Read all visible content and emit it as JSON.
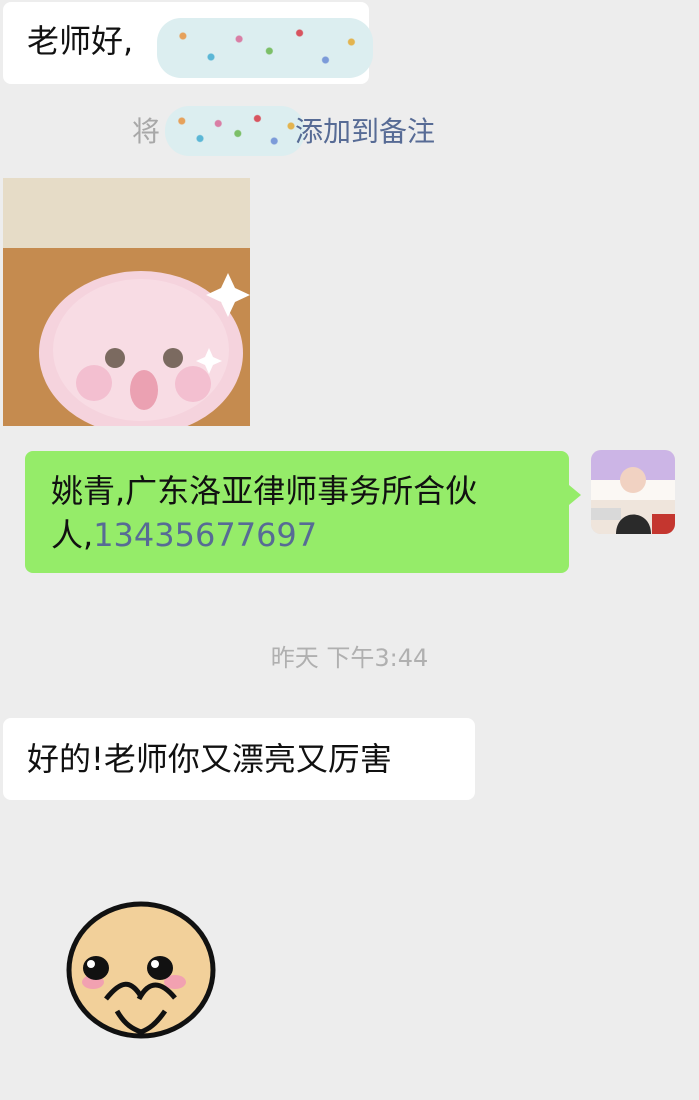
{
  "messages": {
    "first": {
      "text": "老师好,"
    },
    "remark": {
      "prefix": "将",
      "suffix": "添加到备注"
    },
    "intro": {
      "text_prefix": "姚青,广东洛亚律师事务所合伙人,",
      "phone": "13435677697"
    },
    "timestamp": "昨天 下午3:44",
    "reply": {
      "text": "好的!老师你又漂亮又厉害"
    }
  },
  "colors": {
    "background": "#ededed",
    "sent_bubble": "#95ec69",
    "received_bubble": "#ffffff",
    "link": "#576b95"
  },
  "icons": {
    "pig_sticker": "pink-pig-sticker-icon",
    "face_sticker": "shy-face-sticker-icon"
  }
}
